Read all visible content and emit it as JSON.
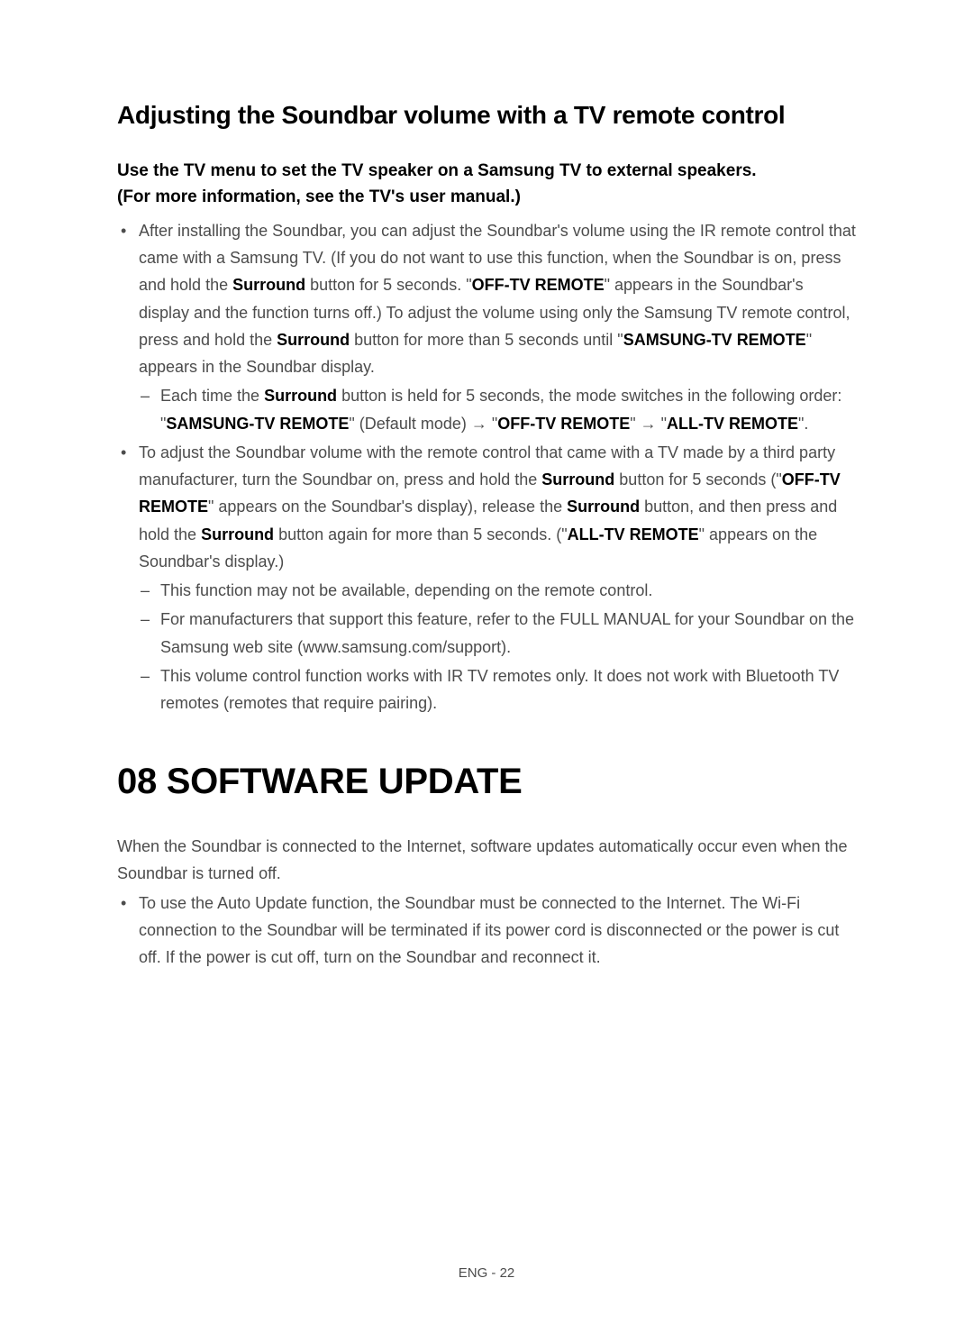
{
  "section": {
    "heading": "Adjusting the Soundbar volume with a TV remote control",
    "subheading_line1": "Use the TV menu to set the TV speaker on a Samsung TV to external speakers.",
    "subheading_line2": "(For more information, see the TV's user manual.)",
    "bullet1": {
      "t1": "After installing the Soundbar, you can adjust the Soundbar's volume using the IR remote control that came with a Samsung TV. (If you do not want to use this function, when the Soundbar is on, press and hold the ",
      "b1": "Surround",
      "t2": " button for 5 seconds. \"",
      "b2": "OFF-TV REMOTE",
      "t3": "\" appears in the Soundbar's display and the function turns off.) To adjust the volume using only the Samsung TV remote control, press and hold the ",
      "b3": "Surround",
      "t4": " button for more than 5 seconds until \"",
      "b4": "SAMSUNG-TV REMOTE",
      "t5": "\" appears in the Soundbar display.",
      "sub1": {
        "t1": "Each time the ",
        "b1": "Surround",
        "t2": " button is held for 5 seconds, the mode switches in the following order: \"",
        "b2": "SAMSUNG-TV REMOTE",
        "t3": "\" (Default mode) → \"",
        "b3": "OFF-TV REMOTE",
        "t4": "\" → \"",
        "b4": "ALL-TV REMOTE",
        "t5": "\"."
      }
    },
    "bullet2": {
      "t1": "To adjust the Soundbar volume with the remote control that came with a TV made by a third party manufacturer, turn the Soundbar on, press and hold the ",
      "b1": "Surround",
      "t2": " button for 5 seconds (\"",
      "b2": "OFF-TV REMOTE",
      "t3": "\" appears on the Soundbar's display), release the ",
      "b3": "Surround",
      "t4": " button, and then press and hold the ",
      "b4": "Surround",
      "t5": " button again for more than 5 seconds. (\"",
      "b5": "ALL-TV REMOTE",
      "t6": "\" appears on the Soundbar's display.)",
      "sub1": "This function may not be available, depending on the remote control.",
      "sub2": "For manufacturers that support this feature, refer to the FULL MANUAL for your Soundbar on the Samsung web site (www.samsung.com/support).",
      "sub3": "This volume control function works with IR TV remotes only. It does not work with Bluetooth TV remotes (remotes that require pairing)."
    }
  },
  "chapter": {
    "heading": "08  SOFTWARE UPDATE",
    "intro": "When the Soundbar is connected to the Internet, software updates automatically occur even when the Soundbar is turned off.",
    "bullet1": "To use the Auto Update function, the Soundbar must be connected to the Internet. The Wi-Fi connection to the Soundbar will be terminated if its power cord is disconnected or the power is cut off. If the power is cut off, turn on the Soundbar and reconnect it."
  },
  "footer": "ENG - 22"
}
